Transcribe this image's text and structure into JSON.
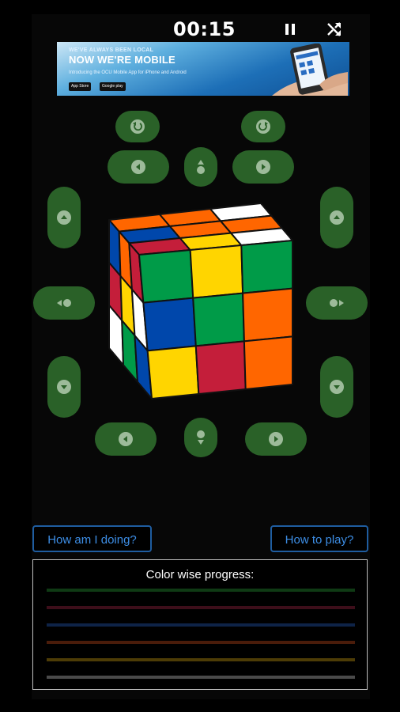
{
  "timer": "00:15",
  "ad": {
    "line1": "WE'VE ALWAYS BEEN LOCAL",
    "line2": "NOW WE'RE MOBILE",
    "line3": "Introducing the OCU Mobile App for iPhone and Android",
    "badge1": "App Store",
    "badge2": "Google play"
  },
  "buttons": {
    "how_am_i_doing": "How am I doing?",
    "how_to_play": "How to play?"
  },
  "progress": {
    "title": "Color wise progress:",
    "bar_colors": [
      "#0f3a14",
      "#3d0e1a",
      "#0e2347",
      "#4a1c0a",
      "#4d3c06",
      "#4a4a4a"
    ]
  },
  "cube": {
    "top_face": [
      [
        "#ff6600",
        "#ff6600",
        "#ffffff"
      ],
      [
        "#0047ab",
        "#ff6600",
        "#ff6600"
      ],
      [
        "#c41e3a",
        "#ffd500",
        "#ffffff"
      ]
    ],
    "front_face": [
      [
        "#009b48",
        "#ffd500",
        "#009b48"
      ],
      [
        "#0047ab",
        "#009b48",
        "#ff6600"
      ],
      [
        "#ffd500",
        "#c41e3a",
        "#ff6600"
      ]
    ],
    "left_face": [
      [
        "#0047ab",
        "#ff6600",
        "#c41e3a"
      ],
      [
        "#c41e3a",
        "#ffd500",
        "#ffffff"
      ],
      [
        "#ffffff",
        "#009b48",
        "#0047ab"
      ]
    ],
    "colors": {
      "white": "#ffffff",
      "yellow": "#ffd500",
      "red": "#c41e3a",
      "orange": "#ff6600",
      "blue": "#0047ab",
      "green": "#009b48"
    }
  },
  "icons": {
    "pause": "pause-icon",
    "shuffle": "shuffle-icon",
    "rotate_ccw": "rotate-ccw-icon",
    "rotate_cw": "rotate-cw-icon",
    "arrow_left": "arrow-left-icon",
    "arrow_right": "arrow-right-icon",
    "arrow_up": "arrow-up-icon",
    "arrow_down": "arrow-down-icon"
  },
  "accent_colors": {
    "control_green": "#2a6128",
    "link_blue": "#3d8ee6"
  }
}
